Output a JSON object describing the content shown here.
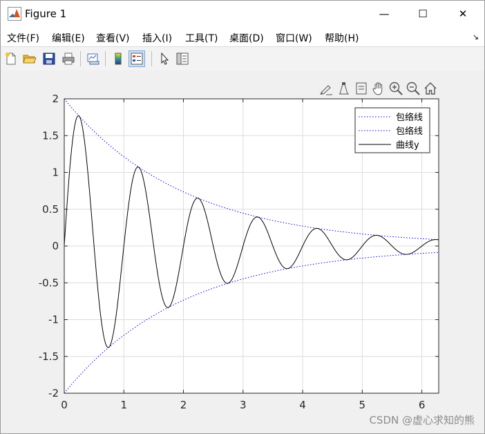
{
  "window": {
    "title": "Figure 1",
    "minimize_glyph": "—",
    "maximize_glyph": "☐",
    "close_glyph": "✕"
  },
  "menu": {
    "items": [
      {
        "label": "文件(F)"
      },
      {
        "label": "编辑(E)"
      },
      {
        "label": "查看(V)"
      },
      {
        "label": "插入(I)"
      },
      {
        "label": "工具(T)"
      },
      {
        "label": "桌面(D)"
      },
      {
        "label": "窗口(W)"
      },
      {
        "label": "帮助(H)"
      }
    ],
    "overflow_glyph": "↘"
  },
  "toolbar": {
    "icons": [
      "new-file-icon",
      "open-folder-icon",
      "save-icon",
      "print-icon",
      "link-plot-icon",
      "colorbar-icon",
      "legend-icon",
      "pointer-icon",
      "property-inspector-icon"
    ]
  },
  "axes_toolbar": {
    "icons": [
      "brush-icon",
      "data-tips-icon",
      "restore-view-icon",
      "pan-icon",
      "zoom-in-icon",
      "zoom-out-icon",
      "home-icon"
    ]
  },
  "chart_data": {
    "type": "line",
    "title": "",
    "xlabel": "",
    "ylabel": "",
    "xlim": [
      0,
      6.283
    ],
    "ylim": [
      -2,
      2
    ],
    "xticks": [
      0,
      1,
      2,
      3,
      4,
      5,
      6
    ],
    "yticks": [
      -2,
      -1.5,
      -1,
      -0.5,
      0,
      0.5,
      1,
      1.5,
      2
    ],
    "xtick_labels": [
      "0",
      "1",
      "2",
      "3",
      "4",
      "5",
      "6"
    ],
    "ytick_labels": [
      "-2",
      "-1.5",
      "-1",
      "-0.5",
      "0",
      "0.5",
      "1",
      "1.5",
      "2"
    ],
    "grid": true,
    "legend_position": "top-right",
    "series": [
      {
        "name": "包络线",
        "style": "dotted",
        "color": "#0000ff",
        "function": "2*exp(-0.5*t)"
      },
      {
        "name": "包络线",
        "style": "dotted",
        "color": "#0000ff",
        "function": "-2*exp(-0.5*t)"
      },
      {
        "name": "曲线y",
        "style": "solid",
        "color": "#000000",
        "function": "2*exp(-0.5*t)*sin(2*pi*t)"
      }
    ]
  },
  "watermark": "CSDN @虚心求知的熊"
}
